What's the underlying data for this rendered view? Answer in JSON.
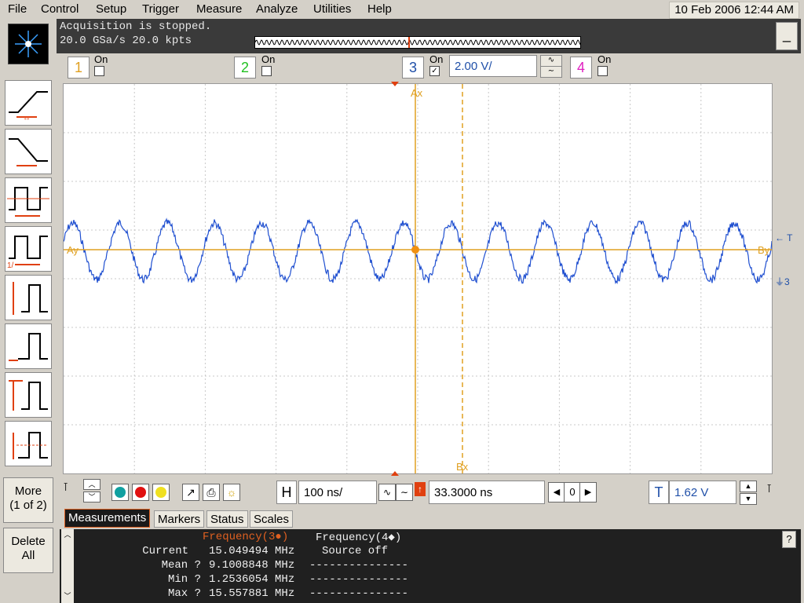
{
  "menu": {
    "items": [
      "File",
      "Control",
      "Setup",
      "Trigger",
      "Measure",
      "Analyze",
      "Utilities",
      "Help"
    ],
    "datetime": "10 Feb 2006 12:44 AM"
  },
  "status": {
    "line1": "Acquisition is stopped.",
    "line2": "20.0 GSa/s   20.0 kpts",
    "minimize_label": "_"
  },
  "channels": [
    {
      "num": "1",
      "on_label": "On",
      "checked": "",
      "color": "#e0a020"
    },
    {
      "num": "2",
      "on_label": "On",
      "checked": "",
      "color": "#20c020"
    },
    {
      "num": "3",
      "on_label": "On",
      "checked": "✓",
      "color": "#1f4fa8",
      "scale": "2.00 V/"
    },
    {
      "num": "4",
      "on_label": "On",
      "checked": "",
      "color": "#e020c0"
    }
  ],
  "left_toolbar": {
    "more_label": "More\n(1 of 2)",
    "delete_label": "Delete\nAll"
  },
  "graticule": {
    "marker_ax": "Ax",
    "marker_bx": "Bx",
    "marker_ay": "Ay",
    "marker_by": "By",
    "trigger_label": "T",
    "ch3_ref_label": "3"
  },
  "controls": {
    "h_label": "H",
    "timebase": "100 ns/",
    "delay": "33.3000 ns",
    "zero": "0",
    "t_label": "T",
    "trigger_level": "1.62 V"
  },
  "tabs": [
    "Measurements",
    "Markers",
    "Status",
    "Scales"
  ],
  "measurements": {
    "header_freq3": "Frequency(3●)",
    "header_freq4": "Frequency(4◆)",
    "rows": [
      {
        "label": "Current",
        "val3": "15.049494 MHz",
        "val4": "Source off"
      },
      {
        "label": "Mean ?",
        "val3": "9.1008848 MHz",
        "val4": "---------------"
      },
      {
        "label": "Min ?",
        "val3": "1.2536054 MHz",
        "val4": "---------------"
      },
      {
        "label": "Max ?",
        "val3": "15.557881 MHz",
        "val4": "---------------"
      }
    ],
    "help_label": "?"
  },
  "colors": {
    "trace": "#1f4fd0",
    "cursor": "#e0a020",
    "trigger_marker": "#e04010",
    "grid": "#c8c8c8"
  }
}
